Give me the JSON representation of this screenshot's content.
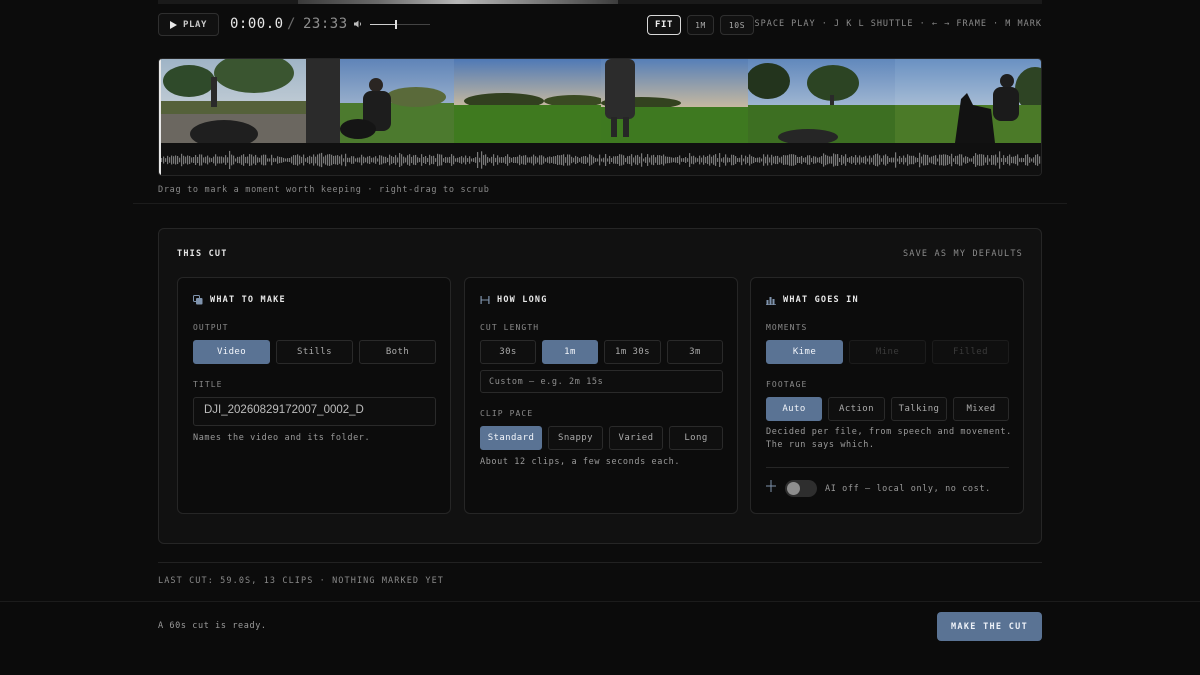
{
  "transport": {
    "play_label": "PLAY",
    "current_time": "0:00.0",
    "separator": "/",
    "total_time": "23:33",
    "volume": 0.43,
    "zoom_options": [
      "FIT",
      "1M",
      "10S"
    ],
    "zoom_selected": "FIT",
    "hotkeys": "SPACE PLAY · J K L SHUTTLE · ← → FRAME · M MARK"
  },
  "timeline": {
    "hint": "Drag to mark a moment worth keeping · right-drag to scrub",
    "thumbnails": [
      "park-trees-dog",
      "man-with-dog",
      "sunset-field",
      "walking-figure",
      "park-trees",
      "dog-jumping"
    ]
  },
  "panel": {
    "title": "THIS CUT",
    "save_defaults": "SAVE AS MY DEFAULTS",
    "make": {
      "title": "WHAT TO MAKE",
      "output_label": "OUTPUT",
      "output_options": [
        "Video",
        "Stills",
        "Both"
      ],
      "output_selected": "Video",
      "title_label": "TITLE",
      "title_value": "DJI_20260829172007_0002_D",
      "title_hint": "Names the video and its folder."
    },
    "length": {
      "title": "HOW LONG",
      "cut_length_label": "CUT LENGTH",
      "length_options": [
        "30s",
        "1m",
        "1m 30s",
        "3m"
      ],
      "length_selected": "1m",
      "custom_placeholder": "Custom — e.g. 2m 15s",
      "pace_label": "CLIP PACE",
      "pace_options": [
        "Standard",
        "Snappy",
        "Varied",
        "Long"
      ],
      "pace_selected": "Standard",
      "pace_hint": "About 12 clips, a few seconds each."
    },
    "goes_in": {
      "title": "WHAT GOES IN",
      "moments_label": "MOMENTS",
      "moments_options": [
        "Kime",
        "Mine",
        "Filled"
      ],
      "moments_selected": "Kime",
      "footage_label": "FOOTAGE",
      "footage_options": [
        "Auto",
        "Action",
        "Talking",
        "Mixed"
      ],
      "footage_selected": "Auto",
      "footage_hint_1": "Decided per file, from speech and movement.",
      "footage_hint_2": "The run says which.",
      "ai_text": "AI off — local only, no cost.",
      "ai_enabled": false
    }
  },
  "status": {
    "last_cut": "LAST CUT: 59.0S, 13 CLIPS · NOTHING MARKED YET",
    "ready": "A 60s cut is ready.",
    "make_button": "MAKE THE CUT"
  },
  "colors": {
    "accent": "#5a7394",
    "background": "#0c0c0c"
  }
}
